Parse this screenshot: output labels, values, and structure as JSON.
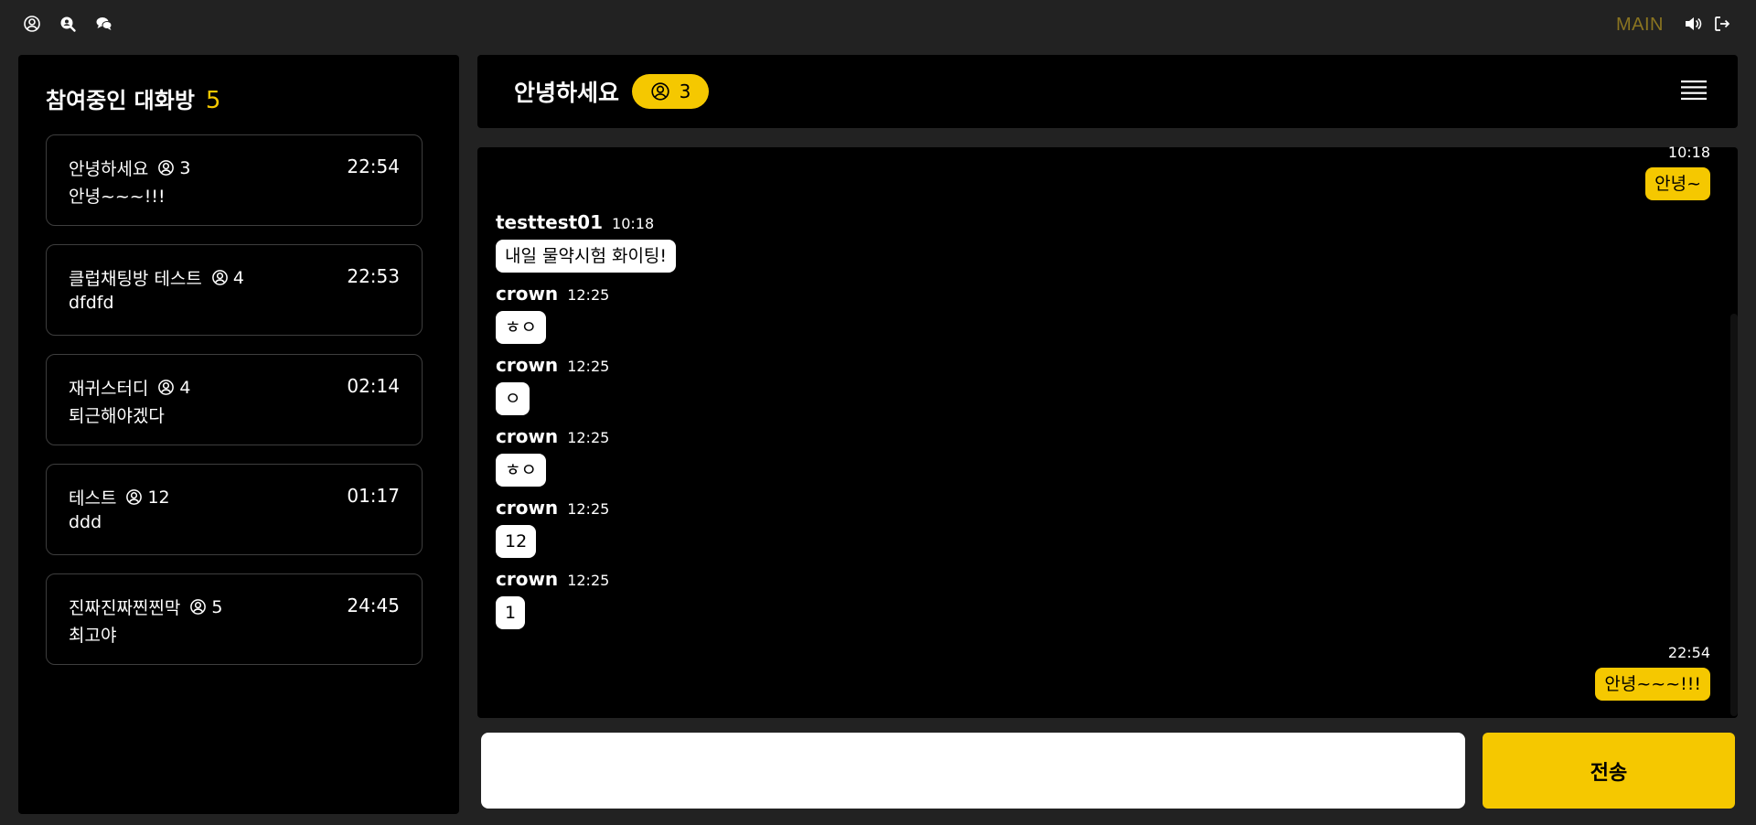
{
  "topbar": {
    "icons": [
      "user-circle-icon",
      "search-user-icon",
      "chat-bubbles-icon"
    ],
    "main_label": "MAIN",
    "right_icons": [
      "speaker-icon",
      "logout-icon"
    ]
  },
  "sidebar": {
    "title": "참여중인 대화방",
    "count": "5",
    "rooms": [
      {
        "name": "안녕하세요",
        "members": "3",
        "time": "22:54",
        "last": "안녕~~~!!!"
      },
      {
        "name": "클럽채팅방 테스트",
        "members": "4",
        "time": "22:53",
        "last": "dfdfd"
      },
      {
        "name": "재귀스터디",
        "members": "4",
        "time": "02:14",
        "last": "퇴근해야겠다"
      },
      {
        "name": "테스트",
        "members": "12",
        "time": "01:17",
        "last": "ddd"
      },
      {
        "name": "진짜진짜찐찐막",
        "members": "5",
        "time": "24:45",
        "last": "최고야"
      }
    ]
  },
  "chat": {
    "title": "안녕하세요",
    "members": "3",
    "messages": [
      {
        "mine": true,
        "time": "10:18",
        "text": "안녕~"
      },
      {
        "mine": false,
        "sender": "testtest01",
        "time": "10:18",
        "text": "내일 물약시험 화이팅!"
      },
      {
        "mine": false,
        "sender": "crown",
        "time": "12:25",
        "text": "ㅎㅇ"
      },
      {
        "mine": false,
        "sender": "crown",
        "time": "12:25",
        "text": "ㅇ"
      },
      {
        "mine": false,
        "sender": "crown",
        "time": "12:25",
        "text": "ㅎㅇ"
      },
      {
        "mine": false,
        "sender": "crown",
        "time": "12:25",
        "text": "12"
      },
      {
        "mine": false,
        "sender": "crown",
        "time": "12:25",
        "text": "1"
      },
      {
        "mine": true,
        "time": "22:54",
        "text": "안녕~~~!!!"
      }
    ]
  },
  "composer": {
    "value": "",
    "placeholder": "",
    "send_label": "전송"
  },
  "colors": {
    "accent": "#f5c800",
    "background": "#000000",
    "topbar": "#222222",
    "main_link": "#8a7420"
  }
}
